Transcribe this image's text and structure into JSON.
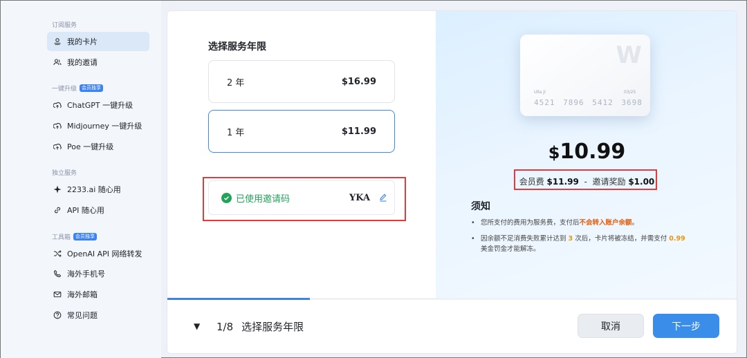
{
  "sidebar": {
    "sections": [
      {
        "title": "订阅服务",
        "badge": ""
      },
      {
        "title": "一键升级",
        "badge": "会员独享"
      },
      {
        "title": "独立服务",
        "badge": ""
      },
      {
        "title": "工具箱",
        "badge": "会员独享"
      }
    ],
    "items": [
      {
        "label": "我的卡片",
        "icon": "card-stack-icon"
      },
      {
        "label": "我的邀请",
        "icon": "users-icon"
      },
      {
        "label": "ChatGPT 一键升级",
        "icon": "upgrade-icon"
      },
      {
        "label": "Midjourney 一键升级",
        "icon": "upgrade-icon"
      },
      {
        "label": "Poe 一键升级",
        "icon": "upgrade-icon"
      },
      {
        "label": "2233.ai 随心用",
        "icon": "sparkle-icon"
      },
      {
        "label": "API 随心用",
        "icon": "link-icon"
      },
      {
        "label": "OpenAI API 网络转发",
        "icon": "shuffle-icon"
      },
      {
        "label": "海外手机号",
        "icon": "phone-icon"
      },
      {
        "label": "海外邮箱",
        "icon": "mail-icon"
      },
      {
        "label": "常见问题",
        "icon": "question-icon"
      }
    ],
    "active_index": 0
  },
  "left": {
    "title": "选择服务年限",
    "plans": [
      {
        "duration": "2 年",
        "price": "$16.99"
      },
      {
        "duration": "1 年",
        "price": "$11.99"
      }
    ],
    "selected_plan": 1,
    "invite": {
      "label": "已使用邀请码",
      "code": "YKA"
    }
  },
  "card": {
    "logo": "W",
    "holder": "Ulla Ji",
    "expiry": "03/25",
    "number": "4521 7896 5412 3698"
  },
  "summary": {
    "currency": "$",
    "amount": "10.99",
    "fee_label": "会员费",
    "fee_value": "$11.99",
    "separator": "-",
    "reward_label": "邀请奖励",
    "reward_value": "$1.00"
  },
  "notice": {
    "title": "须知",
    "item1_a": "您所支付的费用为服务费，支付后",
    "item1_b": "不会转入账户余额",
    "item1_c": "。",
    "item2_a": "因余额不足消费失败累计达到",
    "item2_b": "3",
    "item2_c": "次后，卡片将被冻结，并需支付",
    "item2_d": "0.99",
    "item2_e": "美金罚金才能解冻。"
  },
  "footer": {
    "step": "1/8",
    "step_label": "选择服务年限",
    "progress": 0.25,
    "cancel": "取消",
    "next": "下一步"
  },
  "colors": {
    "accent": "#3a8ee9",
    "success": "#22a35a",
    "highlight": "#e23b3b",
    "warning": "#e25b0a"
  }
}
